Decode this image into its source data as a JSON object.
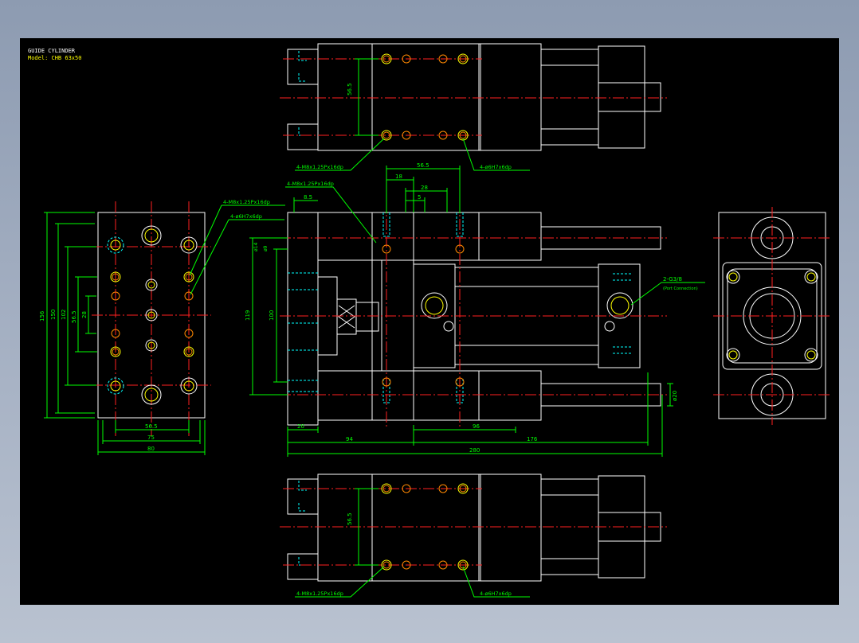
{
  "title_block": {
    "name": "GUIDE CYLINDER",
    "model": "Model: CHB 63x50"
  },
  "colors": {
    "outline": "#ffffff",
    "center_line": "#ff2020",
    "dimension": "#00ff00",
    "hidden": "#00ffff",
    "hole": "#ffff00",
    "hole_alt": "#ff8800"
  },
  "annotations": {
    "top_tap": "4-M8x1.25Px16dp",
    "top_hole": "4-ø6H7x6dp",
    "top_vdim": "56.5",
    "side_tap": "4-M8x1.25Px16dp",
    "side_hole": "4-ø6H7x6dp",
    "port": "2-G3/8",
    "port_sub": "(Port Connection)",
    "bottom_tap": "4-M8x1.25Px16dp",
    "bottom_hole": "4-ø6H7x6dp",
    "bottom_vdim": "56.5"
  },
  "left_view_dims": {
    "d_156": "156",
    "d_150": "150",
    "d_102": "102",
    "d_565": "56.5",
    "d_28": "28",
    "d_565b": "56.5",
    "d_75": "75",
    "d_80": "80"
  },
  "front_view_dims": {
    "d_565": "56.5",
    "d_18": "18",
    "d_28": "28",
    "d_5": "5",
    "d_85": "8.5",
    "d_o14": "ø14",
    "d_o9": "ø9",
    "d_119": "119",
    "d_100": "100",
    "d_20": "20",
    "d_94": "94",
    "d_96": "96",
    "d_176": "176",
    "d_280": "280",
    "d_o20": "ø20"
  }
}
